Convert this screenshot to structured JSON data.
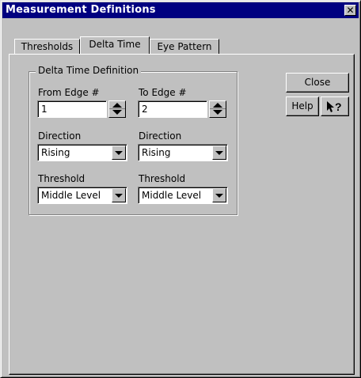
{
  "window": {
    "title": "Measurement Definitions",
    "close_glyph": "✕"
  },
  "tabs": [
    {
      "label": "Thresholds",
      "active": false
    },
    {
      "label": "Delta Time",
      "active": true
    },
    {
      "label": "Eye Pattern",
      "active": false
    }
  ],
  "group": {
    "title": "Delta Time Definition",
    "from": {
      "edge_label": "From Edge #",
      "edge_value": "1",
      "direction_label": "Direction",
      "direction_value": "Rising",
      "threshold_label": "Threshold",
      "threshold_value": "Middle Level"
    },
    "to": {
      "edge_label": "To Edge #",
      "edge_value": "2",
      "direction_label": "Direction",
      "direction_value": "Rising",
      "threshold_label": "Threshold",
      "threshold_value": "Middle Level"
    }
  },
  "buttons": {
    "close": "Close",
    "help": "Help",
    "whats_this_icon": "arrow-question-icon"
  }
}
